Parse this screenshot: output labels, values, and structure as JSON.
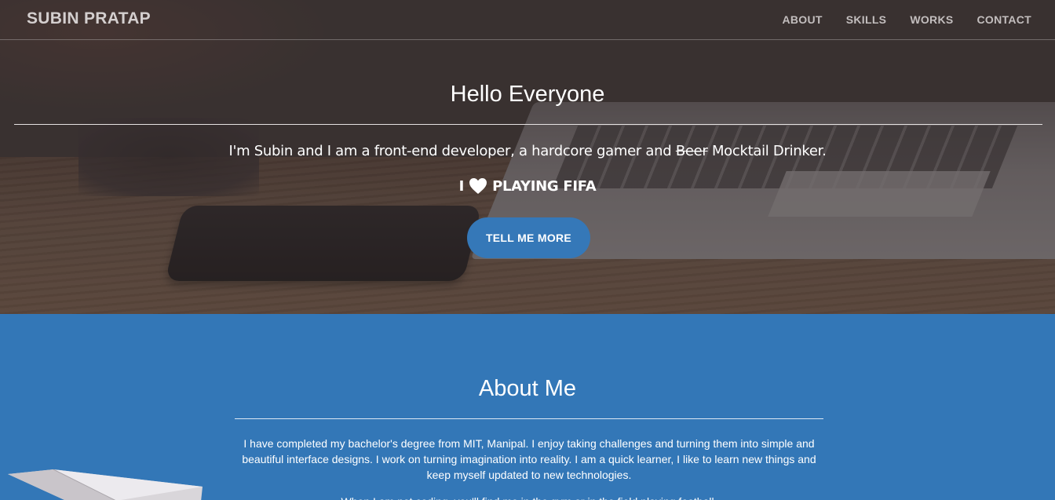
{
  "navbar": {
    "brand": "SUBIN PRATAP",
    "links": [
      {
        "label": "ABOUT"
      },
      {
        "label": "SKILLS"
      },
      {
        "label": "WORKS"
      },
      {
        "label": "CONTACT"
      }
    ]
  },
  "hero": {
    "title": "Hello Everyone",
    "intro_before": "I'm Subin and I am a front-end developer, a hardcore gamer and ",
    "intro_strike": "Beer",
    "intro_after": " Mocktail Drinker.",
    "love_prefix": "I",
    "love_icon": "heart-icon",
    "love_suffix": "PLAYING FIFA",
    "cta_label": "TELL ME MORE"
  },
  "about": {
    "title": "About Me",
    "paragraph": "I have completed my bachelor's degree from MIT, Manipal. I enjoy taking challenges and turning them into simple and beautiful interface designs. I work on turning imagination into reality. I am a quick learner, I like to learn new things and keep myself updated to new technologies.",
    "paragraph2": "When I am not coding, you'll find me in the gym or in the field playing football."
  },
  "colors": {
    "accent": "#3578b8",
    "about_bg": "#3377b7",
    "hero_overlay": "#342c2c"
  }
}
